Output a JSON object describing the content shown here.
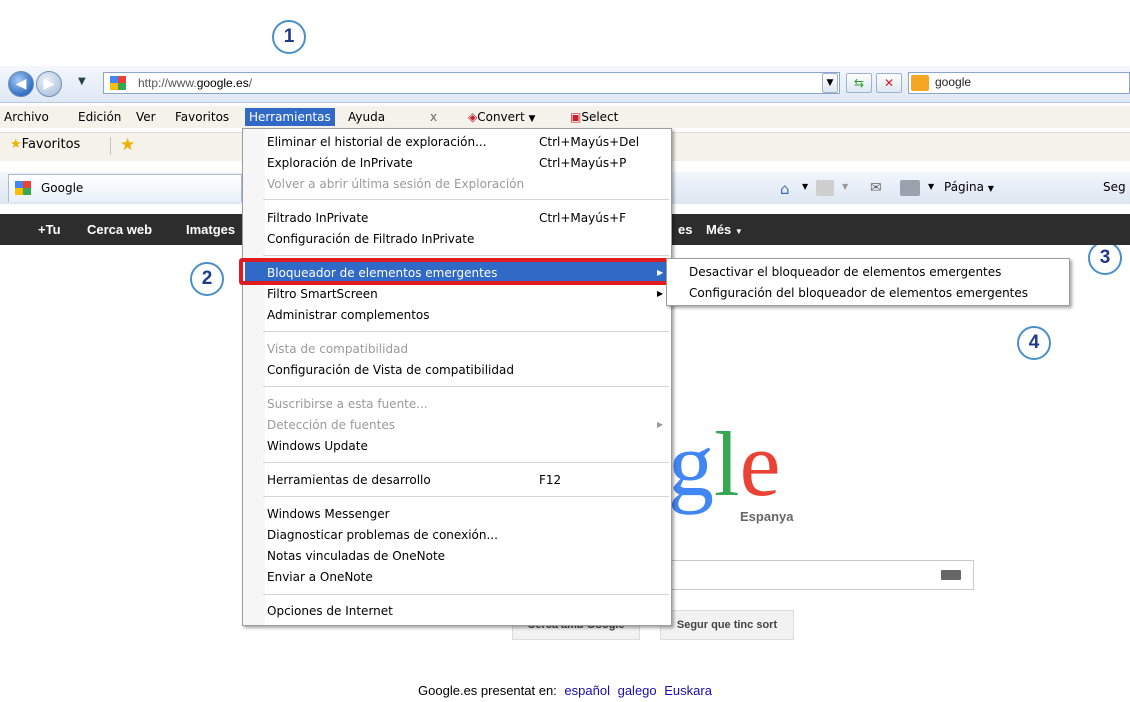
{
  "callouts": [
    "1",
    "2",
    "3",
    "4"
  ],
  "address_bar": {
    "url_prefix": "http://www.",
    "url_domain": "google.es",
    "url_suffix": "/",
    "search_text": "google"
  },
  "menubar": {
    "items": [
      "Archivo",
      "Edición",
      "Ver",
      "Favoritos",
      "Herramientas",
      "Ayuda"
    ],
    "close_glyph": "x",
    "convert_label": "Convert",
    "select_label": "Select"
  },
  "favorites_bar": {
    "favorites_label": "Favoritos"
  },
  "tab": {
    "title": "Google"
  },
  "command_bar": {
    "page_label": "Página",
    "safety_partial": "Seg"
  },
  "google_bar": {
    "items": [
      "+Tu",
      "Cerca web",
      "Imatges",
      "es",
      "Més"
    ]
  },
  "tools_menu": {
    "items": [
      {
        "label": "Eliminar el historial de exploración...",
        "shortcut": "Ctrl+Mayús+Del",
        "disabled": false
      },
      {
        "label": "Exploración de InPrivate",
        "shortcut": "Ctrl+Mayús+P",
        "disabled": false
      },
      {
        "label": "Volver a abrir última sesión de Exploración",
        "shortcut": "",
        "disabled": true
      },
      {
        "label": "Filtrado InPrivate",
        "shortcut": "Ctrl+Mayús+F",
        "disabled": false
      },
      {
        "label": "Configuración de Filtrado InPrivate",
        "shortcut": "",
        "disabled": false
      },
      {
        "label": "Bloqueador de elementos emergentes",
        "shortcut": "",
        "disabled": false,
        "highlighted": true,
        "submenu": true
      },
      {
        "label": "Filtro SmartScreen",
        "shortcut": "",
        "disabled": false,
        "submenu": true
      },
      {
        "label": "Administrar complementos",
        "shortcut": "",
        "disabled": false
      },
      {
        "label": "Vista de compatibilidad",
        "shortcut": "",
        "disabled": true
      },
      {
        "label": "Configuración de Vista de compatibilidad",
        "shortcut": "",
        "disabled": false
      },
      {
        "label": "Suscribirse a esta fuente...",
        "shortcut": "",
        "disabled": true
      },
      {
        "label": "Detección de fuentes",
        "shortcut": "",
        "disabled": true,
        "submenu": true
      },
      {
        "label": "Windows Update",
        "shortcut": "",
        "disabled": false
      },
      {
        "label": "Herramientas de desarrollo",
        "shortcut": "F12",
        "disabled": false
      },
      {
        "label": "Windows Messenger",
        "shortcut": "",
        "disabled": false
      },
      {
        "label": "Diagnosticar problemas de conexión...",
        "shortcut": "",
        "disabled": false
      },
      {
        "label": "Notas vinculadas de OneNote",
        "shortcut": "",
        "disabled": false
      },
      {
        "label": "Enviar a OneNote",
        "shortcut": "",
        "disabled": false
      },
      {
        "label": "Opciones de Internet",
        "shortcut": "",
        "disabled": false
      }
    ]
  },
  "submenu": {
    "items": [
      "Desactivar el bloqueador de elementos emergentes",
      "Configuración del bloqueador de elementos emergentes"
    ]
  },
  "google_page": {
    "logo_visible": "gle",
    "logo_sub": "Espanya",
    "search_button": "Cerca amb Google",
    "lucky_button": "Segur que tinc sort",
    "footer_text": "Google.es presentat en:",
    "footer_links": [
      "español",
      "galego",
      "Euskara"
    ]
  },
  "colors": {
    "menu_highlight": "#3169c6",
    "callout_ring": "#4a90c8",
    "red_outline": "#e01b22",
    "google_bar": "#2d2d2d"
  }
}
